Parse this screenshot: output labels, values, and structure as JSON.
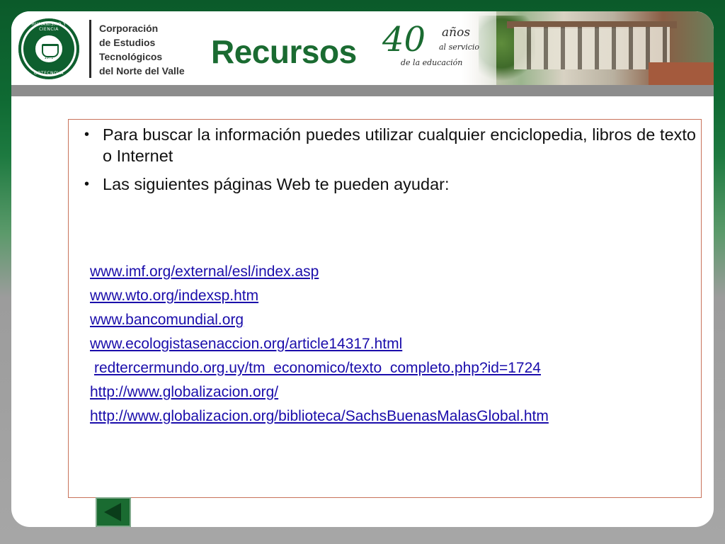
{
  "header": {
    "org_name_lines": [
      "Corporación",
      "de Estudios",
      "Tecnológicos",
      "del Norte del Valle"
    ],
    "title": "Recursos",
    "seal": {
      "top_text": "HUMANISMO Y CIENCIA",
      "bottom_text": "COTECNOVA",
      "year": "1971"
    },
    "anniversary": {
      "number": "40",
      "anos": "años",
      "servicio": "al servicio",
      "educacion": "de la educación"
    }
  },
  "content": {
    "bullets": [
      "Para buscar la información puedes utilizar cualquier enciclopedia, libros de texto o Internet",
      "Las siguientes páginas Web te pueden ayudar:"
    ],
    "links": [
      "www.imf.org/external/esl/index.asp",
      "www.wto.org/indexsp.htm",
      "www.bancomundial.org",
      "www.ecologistasenaccion.org/article14317.html",
      "redtercermundo.org.uy/tm_economico/texto_completo.php?id=1724",
      "http://www.globalizacion.org/",
      "http://www.globalizacion.org/biblioteca/SachsBuenasMalasGlobal.htm"
    ]
  },
  "navigation": {
    "back_icon": "triangle-left-icon"
  },
  "colors": {
    "brand_green": "#1a6b31",
    "link_blue": "#1a0dab",
    "box_border": "#c8725a"
  }
}
